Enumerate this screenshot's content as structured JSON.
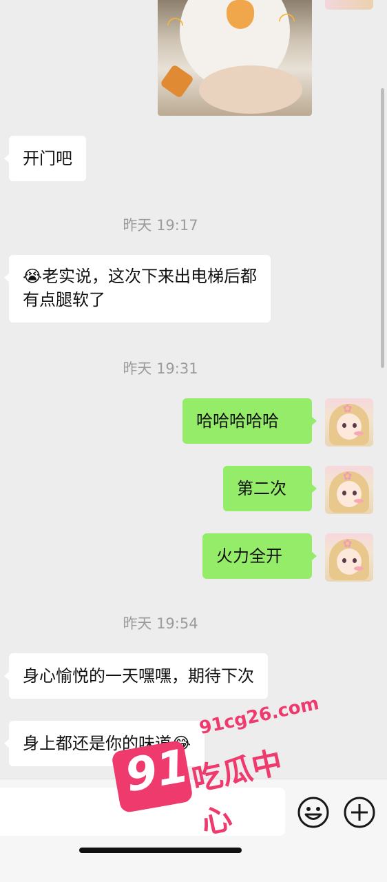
{
  "messages": [
    {
      "type": "incoming",
      "text": "开门吧"
    },
    {
      "type": "timestamp",
      "text": "昨天 19:17"
    },
    {
      "type": "incoming",
      "lines": [
        "😭老实说，这次下来出电梯后都",
        "有点腿软了"
      ]
    },
    {
      "type": "timestamp",
      "text": "昨天 19:31"
    },
    {
      "type": "outgoing",
      "text": "哈哈哈哈哈"
    },
    {
      "type": "outgoing",
      "text": "第二次"
    },
    {
      "type": "outgoing",
      "text": "火力全开"
    },
    {
      "type": "timestamp",
      "text": "昨天 19:54"
    },
    {
      "type": "incoming",
      "text": "身心愉悦的一天嘿嘿，期待下次"
    },
    {
      "type": "incoming",
      "text": "身上都还是你的味道😂"
    }
  ],
  "icons": {
    "emoji_button": "smiley-face-icon",
    "more_button": "plus-circle-icon"
  },
  "watermark": {
    "number": "91",
    "url": "91cg26.com",
    "name": "吃瓜中心"
  },
  "colors": {
    "background": "#ededed",
    "incoming_bubble": "#ffffff",
    "outgoing_bubble": "#95ec69",
    "timestamp": "#9b9b9b",
    "watermark": "#ef3a6e"
  }
}
